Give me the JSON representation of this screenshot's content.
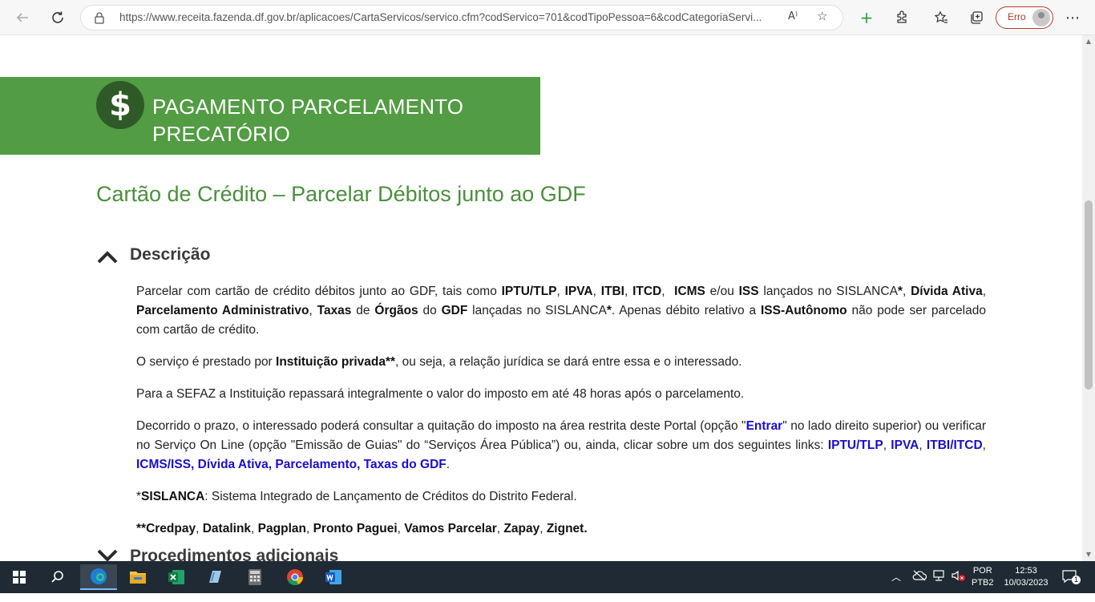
{
  "browser": {
    "url": "https://www.receita.fazenda.df.gov.br/aplicacoes/CartaServicos/servico.cfm?codServico=701&codTipoPessoa=6&codCategoriaServi...",
    "profile_status": "Erro"
  },
  "banner": {
    "icon_glyph": "$",
    "title_line1": "PAGAMENTO PARCELAMENTO",
    "title_line2": "PRECATÓRIO"
  },
  "subtitle": "Cartão de Crédito – Parcelar Débitos junto ao GDF",
  "section": {
    "label": "Descrição"
  },
  "paragraphs": {
    "p1": {
      "a": "Parcelar com cartão de crédito débitos junto ao GDF, tais como ",
      "b1": "IPTU/TLP",
      "c1": ", ",
      "b2": "IPVA",
      "c2": ", ",
      "b3": "ITBI",
      "c3": ", ",
      "b4": "ITCD",
      "c4": ",  ",
      "b5": "ICMS",
      "c5": " e/ou ",
      "b6": "ISS",
      "c6": " lançados no SISLANCA",
      "b7": "*",
      "c7": ", ",
      "b8": "Dívida Ativa",
      "c8": ", ",
      "b9": "Parcelamento Administrativo",
      "c9": ", ",
      "b10": "Taxas",
      "c10": " de ",
      "b11": "Órgãos",
      "c11": " do ",
      "b12": "GDF",
      "c12": " lançadas no SISLANCA",
      "b13": "*",
      "c13": ". Apenas débito relativo a ",
      "b14": "ISS-Autônomo",
      "c14": " não pode ser parcelado com cartão de crédito."
    },
    "p2": {
      "a": "O serviço é prestado por ",
      "b": "Instituição privada**",
      "c": ", ou seja, a relação jurídica se dará entre essa e o interessado."
    },
    "p3": "Para a SEFAZ a Instituição repassará integralmente o valor do imposto em até 48 horas após o parcelamento.",
    "p4": {
      "a": "Decorrido o prazo, o interessado poderá consultar a quitação do imposto na área restrita deste Portal (opção \"",
      "link_entrar": "Entrar",
      "b": "\" no lado direito superior) ou verificar no Serviço On Line (opção \"Emissão de Guias\" do “Serviços Área Pública”) ou, ainda, clicar sobre um dos seguintes links: ",
      "links": [
        "IPTU/TLP",
        "IPVA",
        "ITBI/ITCD",
        "ICMS/ISS, Dívida Ativa, Parcelamento, Taxas do GDF"
      ],
      "sep": ", ",
      "end": "."
    },
    "p5": {
      "a": "*",
      "b": "SISLANCA",
      "c": ": Sistema Integrado de Lançamento de Créditos do Distrito Federal."
    },
    "p6": {
      "a": "**",
      "items": [
        "Credpay",
        "Datalink",
        "Pagplan",
        "Pronto Paguei",
        "Vamos Parcelar",
        "Zapay",
        "Zignet."
      ]
    }
  },
  "next_section": "Procedimentos adicionais",
  "taskbar": {
    "lang_line1": "POR",
    "lang_line2": "PTB2",
    "time": "12:53",
    "date": "10/03/2023",
    "notifications": "1"
  },
  "colors": {
    "banner_green": "#529c43",
    "subtitle_green": "#4a8f3c",
    "link_blue": "#1a0dcc",
    "taskbar_bg": "#1f2a34"
  }
}
